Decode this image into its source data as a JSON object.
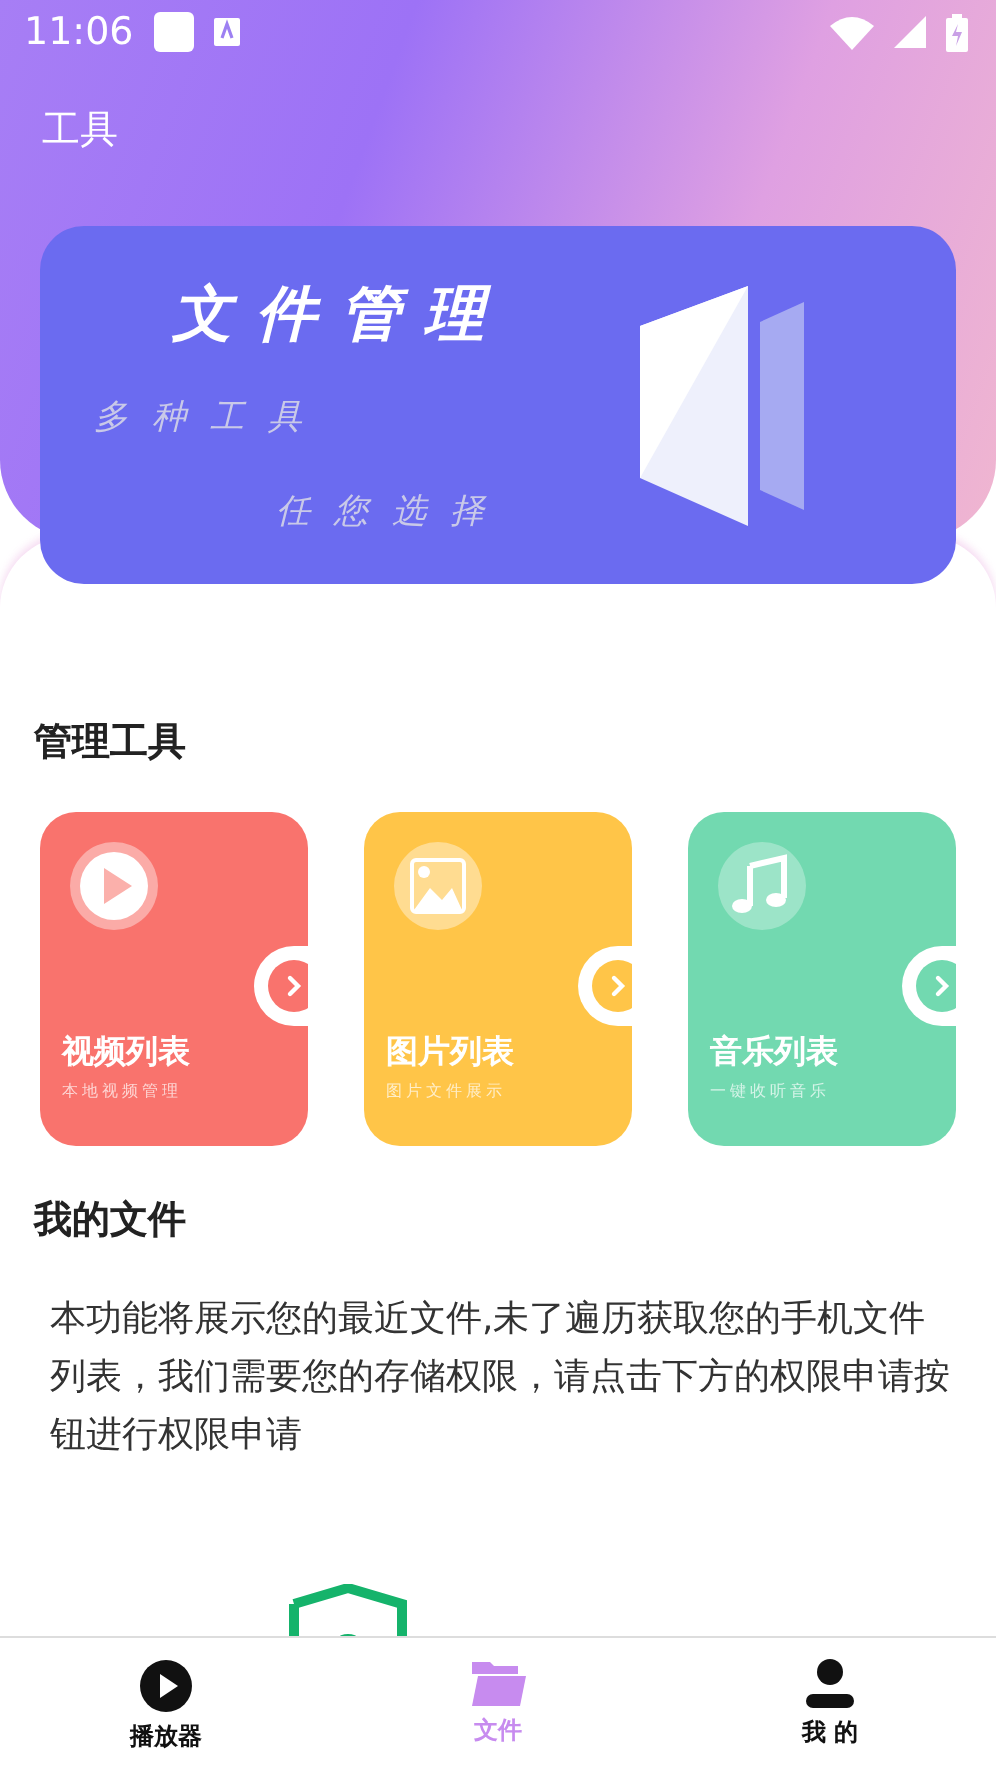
{
  "status_bar": {
    "time": "11:06"
  },
  "header": {
    "title": "工具"
  },
  "banner": {
    "title": "文件管理",
    "line_1": "多种工具",
    "line_2": "任您选择"
  },
  "tools": {
    "title": "管理工具",
    "items": [
      {
        "kind": "video",
        "title": "视频列表",
        "subtitle": "本地视频管理",
        "color": "#f9736d"
      },
      {
        "kind": "image",
        "title": "图片列表",
        "subtitle": "图片文件展示",
        "color": "#ffc548"
      },
      {
        "kind": "music",
        "title": "音乐列表",
        "subtitle": "一键收听音乐",
        "color": "#72d9b0"
      }
    ]
  },
  "my_files": {
    "title": "我的文件",
    "notice": "本功能将展示您的最近文件,未了遍历获取您的手机文件列表，我们需要您的存储权限，请点击下方的权限申请按钮进行权限申请"
  },
  "bottom_nav": [
    {
      "kind": "player",
      "label": "播放器",
      "selected": false
    },
    {
      "kind": "files",
      "label": "文件",
      "selected": true
    },
    {
      "kind": "me",
      "label": "我 的",
      "selected": false
    }
  ]
}
